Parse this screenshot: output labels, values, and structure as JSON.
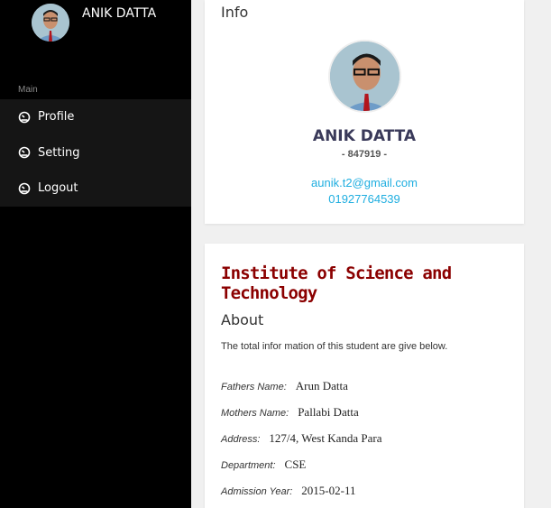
{
  "sidebar": {
    "user_name": "ANIK DATTA",
    "section_label": "Main",
    "items": [
      {
        "label": "Profile",
        "icon": "dashboard-icon"
      },
      {
        "label": "Setting",
        "icon": "dashboard-icon"
      },
      {
        "label": "Logout",
        "icon": "dashboard-icon"
      }
    ]
  },
  "info": {
    "title": "Info",
    "name": "ANIK DATTA",
    "id": "- 847919 -",
    "email": "aunik.t2@gmail.com",
    "phone": "01927764539"
  },
  "about": {
    "institute": "Institute of Science and Technology",
    "title": "About",
    "description": "The total infor mation of this student are give below.",
    "fields": [
      {
        "label": "Fathers Name:",
        "value": "Arun Datta"
      },
      {
        "label": "Mothers Name:",
        "value": "Pallabi Datta"
      },
      {
        "label": "Address:",
        "value": "127/4, West Kanda Para"
      },
      {
        "label": "Department:",
        "value": "CSE"
      },
      {
        "label": "Admission Year:",
        "value": "2015-02-11"
      }
    ]
  },
  "colors": {
    "sidebar_bg": "#000000",
    "link": "#1faee0",
    "institute": "#8b0000"
  }
}
